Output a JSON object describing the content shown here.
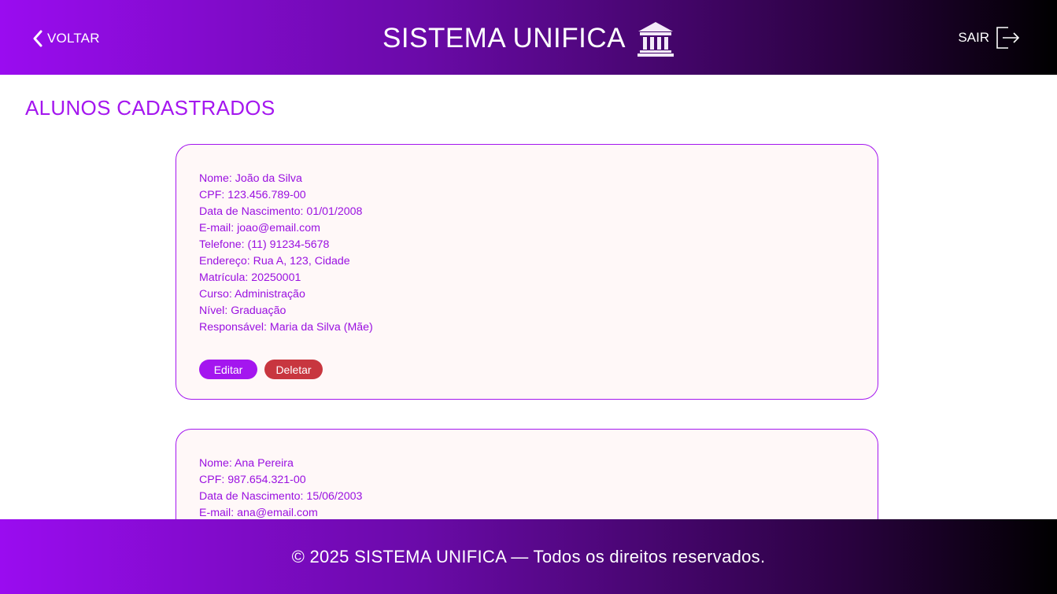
{
  "header": {
    "back_label": "VOLTAR",
    "title": "SISTEMA UNIFICA",
    "title_icon": "bank-building-icon",
    "logout_label": "SAIR",
    "logout_icon": "logout-icon"
  },
  "main": {
    "title": "ALUNOS CADASTRADOS",
    "students": [
      {
        "fields": [
          "Nome: João da Silva",
          "CPF: 123.456.789-00",
          "Data de Nascimento: 01/01/2008",
          "E-mail: joao@email.com",
          "Telefone: (11) 91234-5678",
          "Endereço: Rua A, 123, Cidade",
          "Matrícula: 20250001",
          "Curso: Administração",
          "Nível: Graduação",
          "Responsável: Maria da Silva (Mãe)"
        ],
        "edit_label": "Editar",
        "delete_label": "Deletar"
      },
      {
        "fields": [
          "Nome: Ana Pereira",
          "CPF: 987.654.321-00",
          "Data de Nascimento: 15/06/2003",
          "E-mail: ana@email.com"
        ]
      }
    ]
  },
  "footer": {
    "text": "© 2025 SISTEMA UNIFICA — Todos os direitos reservados."
  },
  "colors": {
    "accent": "#a416ef",
    "delete": "#c8363f",
    "card_background": "#fff8f8",
    "header_gradient_start": "#9a0cf0",
    "header_gradient_end": "#000000"
  }
}
